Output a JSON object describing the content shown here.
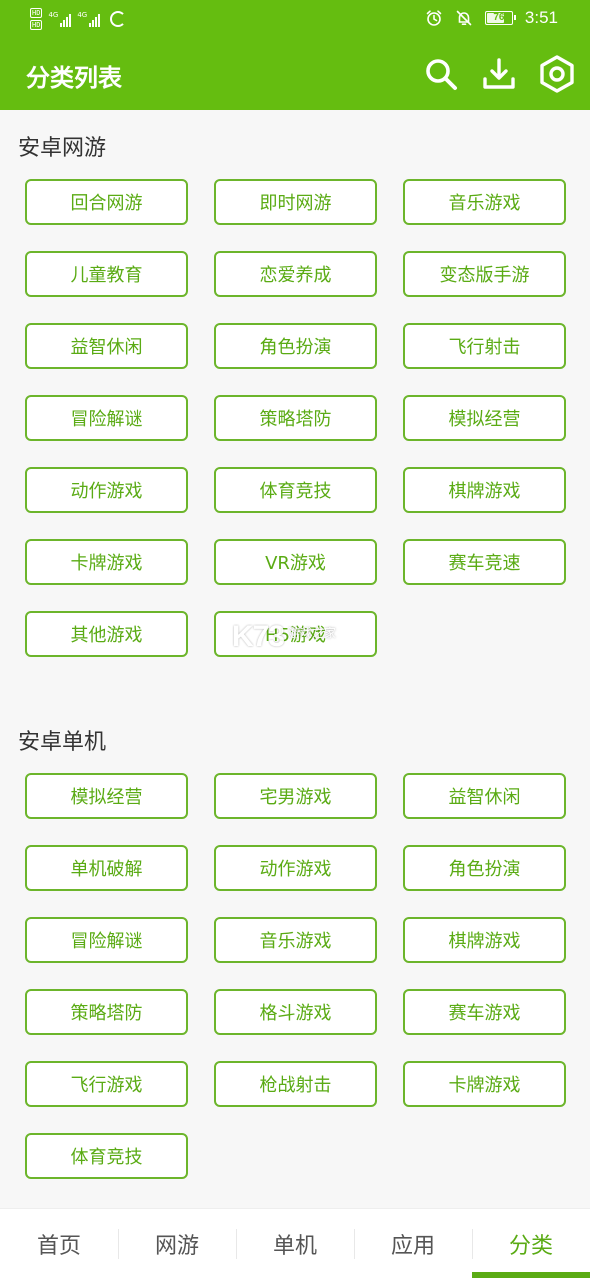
{
  "status_bar": {
    "hd1": "HD",
    "hd2": "HD",
    "net1": "4G",
    "net2": "4G",
    "battery_level": "76",
    "battery_fraction": 0.76,
    "time": "3:51"
  },
  "header": {
    "title": "分类列表"
  },
  "icons": {
    "search": "search-icon",
    "download": "download-icon",
    "settings": "gear-icon"
  },
  "colors": {
    "brand_green": "#65bd10",
    "tag_border": "#6cb52b",
    "tag_text": "#5aab14"
  },
  "sections": [
    {
      "title": "安卓网游",
      "items": [
        "回合网游",
        "即时网游",
        "音乐游戏",
        "儿童教育",
        "恋爱养成",
        "变态版手游",
        "益智休闲",
        "角色扮演",
        "飞行射击",
        "冒险解谜",
        "策略塔防",
        "模拟经营",
        "动作游戏",
        "体育竞技",
        "棋牌游戏",
        "卡牌游戏",
        "VR游戏",
        "赛车竞速",
        "其他游戏",
        "H5游戏"
      ]
    },
    {
      "title": "安卓单机",
      "items": [
        "模拟经营",
        "宅男游戏",
        "益智休闲",
        "单机破解",
        "动作游戏",
        "角色扮演",
        "冒险解谜",
        "音乐游戏",
        "棋牌游戏",
        "策略塔防",
        "格斗游戏",
        "赛车游戏",
        "飞行游戏",
        "枪战射击",
        "卡牌游戏",
        "体育竞技"
      ]
    }
  ],
  "watermark": {
    "logo": "K73",
    "text": "游戏之家"
  },
  "bottom_nav": {
    "items": [
      "首页",
      "网游",
      "单机",
      "应用",
      "分类"
    ],
    "active_index": 4
  }
}
